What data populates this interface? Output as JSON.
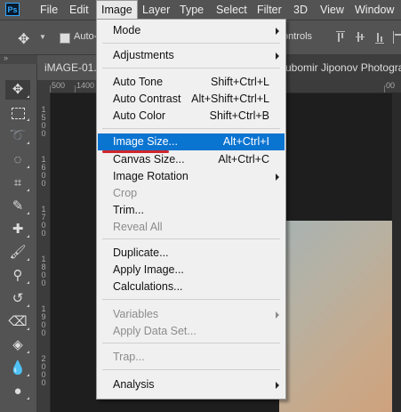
{
  "menubar": {
    "logo": "Ps",
    "items": [
      "File",
      "Edit",
      "Image",
      "Layer",
      "Type",
      "Select",
      "Filter",
      "3D",
      "View",
      "Window"
    ],
    "active": "Image"
  },
  "options": {
    "auto_select_label": "Auto-",
    "transform_controls_label": "ontrols"
  },
  "document": {
    "tab_title": "iMAGE-01.",
    "tab2_title": "ubomir Jiponov Photogra"
  },
  "ruler": {
    "h_labels": [
      "500",
      "1400",
      "00"
    ],
    "v_labels": [
      "1",
      "5",
      "0",
      "0",
      "1",
      "6",
      "0",
      "0",
      "1",
      "7",
      "0",
      "0",
      "1",
      "8",
      "0",
      "0",
      "1",
      "9",
      "0",
      "0",
      "2",
      "0",
      "0",
      "0"
    ]
  },
  "image_menu": {
    "items": [
      {
        "label": "Mode",
        "shortcut": "",
        "submenu": true,
        "disabled": false
      },
      {
        "label": "Adjustments",
        "shortcut": "",
        "submenu": true,
        "disabled": false
      },
      {
        "label": "Auto Tone",
        "shortcut": "Shift+Ctrl+L",
        "submenu": false,
        "disabled": false
      },
      {
        "label": "Auto Contrast",
        "shortcut": "Alt+Shift+Ctrl+L",
        "submenu": false,
        "disabled": false
      },
      {
        "label": "Auto Color",
        "shortcut": "Shift+Ctrl+B",
        "submenu": false,
        "disabled": false
      },
      {
        "label": "Image Size...",
        "shortcut": "Alt+Ctrl+I",
        "submenu": false,
        "disabled": false,
        "highlighted": true
      },
      {
        "label": "Canvas Size...",
        "shortcut": "Alt+Ctrl+C",
        "submenu": false,
        "disabled": false
      },
      {
        "label": "Image Rotation",
        "shortcut": "",
        "submenu": true,
        "disabled": false
      },
      {
        "label": "Crop",
        "shortcut": "",
        "submenu": false,
        "disabled": true
      },
      {
        "label": "Trim...",
        "shortcut": "",
        "submenu": false,
        "disabled": false
      },
      {
        "label": "Reveal All",
        "shortcut": "",
        "submenu": false,
        "disabled": true
      },
      {
        "label": "Duplicate...",
        "shortcut": "",
        "submenu": false,
        "disabled": false
      },
      {
        "label": "Apply Image...",
        "shortcut": "",
        "submenu": false,
        "disabled": false
      },
      {
        "label": "Calculations...",
        "shortcut": "",
        "submenu": false,
        "disabled": false
      },
      {
        "label": "Variables",
        "shortcut": "",
        "submenu": true,
        "disabled": true
      },
      {
        "label": "Apply Data Set...",
        "shortcut": "",
        "submenu": false,
        "disabled": true
      },
      {
        "label": "Trap...",
        "shortcut": "",
        "submenu": false,
        "disabled": true
      },
      {
        "label": "Analysis",
        "shortcut": "",
        "submenu": true,
        "disabled": false
      }
    ]
  },
  "tools": [
    "move-tool",
    "marquee-tool",
    "lasso-tool",
    "quick-selection-tool",
    "crop-tool",
    "eyedropper-tool",
    "healing-brush-tool",
    "brush-tool",
    "clone-stamp-tool",
    "history-brush-tool",
    "eraser-tool",
    "paint-bucket-tool",
    "blur-tool",
    "dodge-tool"
  ],
  "colors": {
    "highlight": "#0a74d1",
    "underline": "#d0262b",
    "chrome": "#535353"
  }
}
